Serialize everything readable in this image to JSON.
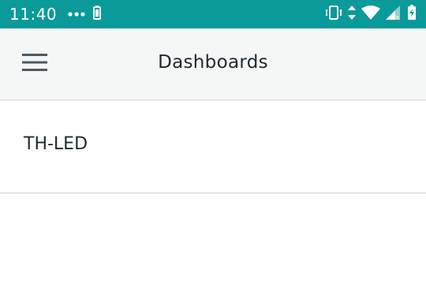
{
  "status_bar": {
    "time": "11:40",
    "background_color": "#0a9a9a",
    "left_icons": [
      "more-dots-icon",
      "battery-saver-icon"
    ],
    "right_icons": [
      "vibrate-icon",
      "data-arrows-icon",
      "wifi-icon",
      "cellular-signal-icon",
      "battery-charging-icon"
    ]
  },
  "app_bar": {
    "title": "Dashboards",
    "menu_icon": "hamburger-menu-icon"
  },
  "dashboards": [
    {
      "label": "TH-LED"
    }
  ]
}
